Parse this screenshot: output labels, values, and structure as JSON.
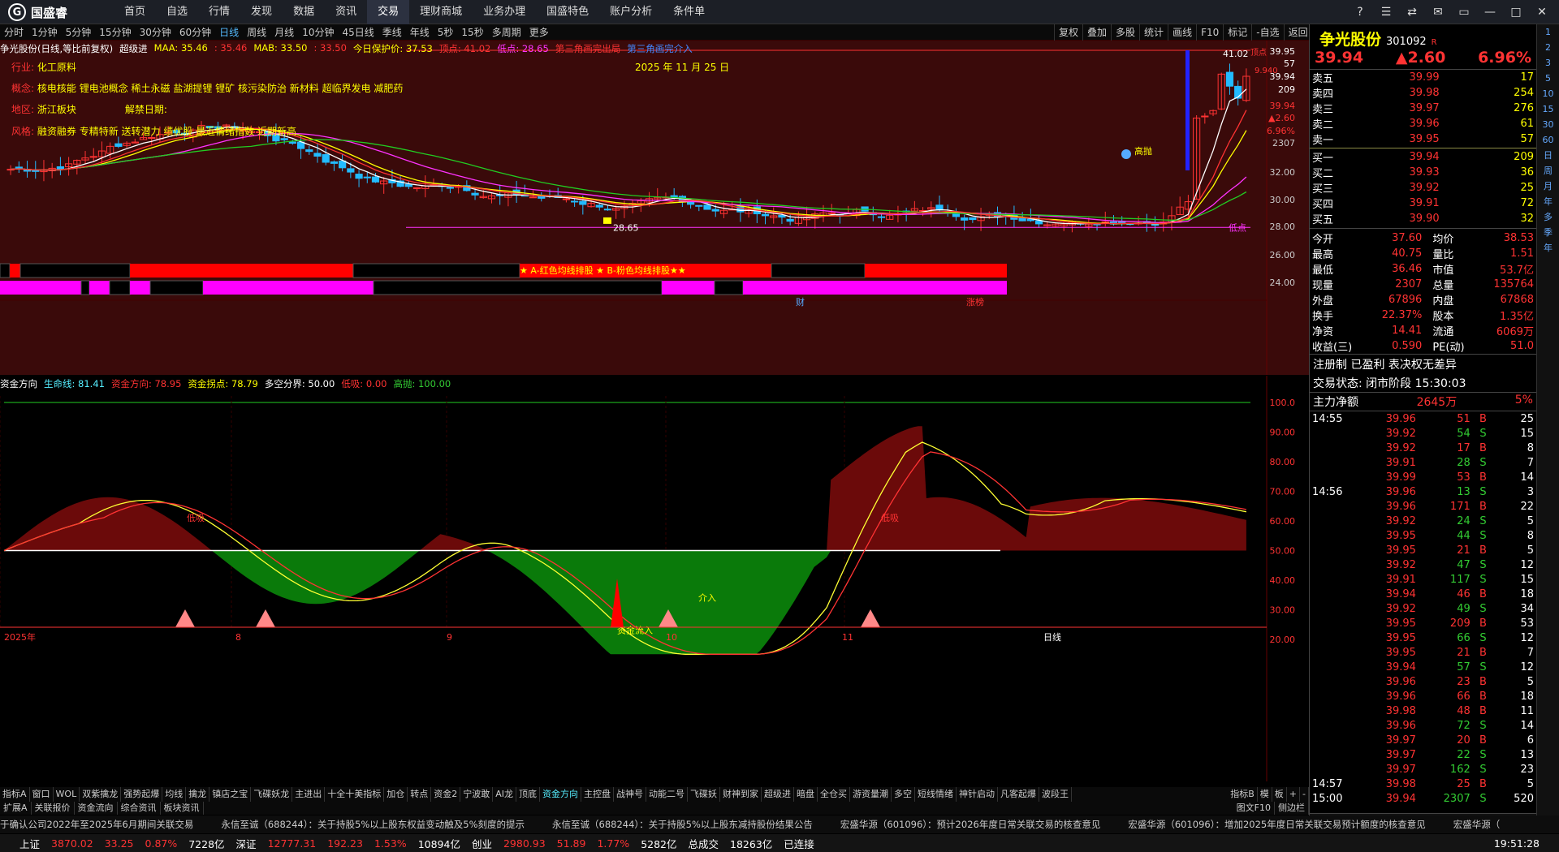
{
  "app": {
    "name": "国盛睿"
  },
  "menu": [
    "首页",
    "自选",
    "行情",
    "发现",
    "数据",
    "资讯",
    "交易",
    "理财商城",
    "业务办理",
    "国盛特色",
    "账户分析",
    "条件单"
  ],
  "menu_active": 6,
  "window_controls": [
    "?",
    "☰",
    "⇄",
    "✉",
    "▭",
    "—",
    "□",
    "✕"
  ],
  "periods": [
    "分时",
    "1分钟",
    "5分钟",
    "15分钟",
    "30分钟",
    "60分钟",
    "日线",
    "周线",
    "月线",
    "10分钟",
    "45日线",
    "季线",
    "年线",
    "5秒",
    "15秒",
    "多周期",
    "更多"
  ],
  "periods_active": 6,
  "tools": [
    "复权",
    "叠加",
    "多股",
    "统计",
    "画线",
    "F10",
    "标记",
    "-自选",
    "返回"
  ],
  "kline": {
    "title": "争光股份(日线,等比前复权)",
    "indicator": "超级进",
    "maa": "MAA: 35.46",
    "maa2": ": 35.46",
    "mab": "MAB: 33.50",
    "mab2": ": 33.50",
    "guard": "今日保护价: 37.53",
    "top": "顶点: 41.02",
    "bottom": "低点: 28.65",
    "t3": "第三角画完出局",
    "t3b": "第三角画完介入",
    "date_label": "2025 年 11 月 25 日",
    "industry_k": "行业:",
    "industry_v": "化工原料",
    "concept_k": "概念:",
    "concept_v": "核电核能 锂电池概念 稀土永磁 盐湖提锂 锂矿 核污染防治 新材料 超临界发电 减肥药",
    "region_k": "地区:",
    "region_v": "浙江板块",
    "ban_k": "解禁日期:",
    "style_k": "风格:",
    "style_v": "融资融券 专精特新 送转潜力 绩优股 最近情绪指数 近期新高",
    "high_val": "41.02",
    "high_tag": "顶点",
    "low_val": "28.65",
    "low_tag": "低点",
    "gaopao": "高抛",
    "close_tag": "9.940",
    "strip_text": "★ A-红色均线排股 ★ B-粉色均线排股★★",
    "cai": "财",
    "zhangting": "涨榜",
    "y_ticks": [
      "39.95",
      "57",
      "39.94",
      "209",
      "39.94",
      "▲2.60",
      "6.96%",
      "2307",
      "32.00",
      "30.00",
      "28.00",
      "26.00",
      "24.00"
    ]
  },
  "ind": {
    "title": "资金方向",
    "life": "生命线: 81.41",
    "dir": "资金方向: 78.95",
    "turn": "资金拐点: 78.79",
    "split": "多空分界: 50.00",
    "low": "低吸: 0.00",
    "high": "高抛: 100.00",
    "labels": {
      "diba": "低吸",
      "in1": "资金流入",
      "in2": "介入",
      "dibu2": "低吸"
    },
    "y_ticks": [
      "100.0",
      "90.00",
      "80.00",
      "70.00",
      "60.00",
      "50.00",
      "40.00",
      "30.00",
      "20.00"
    ],
    "x_ticks": [
      "2025年",
      "8",
      "9",
      "10",
      "11"
    ]
  },
  "chart_data": {
    "type": "line",
    "x": [
      "2025-07",
      "2025-08",
      "2025-09",
      "2025-10",
      "2025-11"
    ],
    "series": [
      {
        "name": "生命线",
        "values": [
          70,
          62,
          30,
          45,
          81.41
        ]
      },
      {
        "name": "资金方向",
        "values": [
          68,
          63,
          28,
          42,
          78.95
        ]
      }
    ],
    "ylim": [
      0,
      100
    ]
  },
  "bottomtabs": [
    "指标A",
    "窗口",
    "WOL",
    "双紫擒龙",
    "强势起爆",
    "均线",
    "擒龙",
    "镇店之宝",
    "飞碟妖龙",
    "主进出",
    "十全十美指标",
    "加仓",
    "转点",
    "资金2",
    "宁波敢",
    "AI龙",
    "顶底",
    "资金方向",
    "主控盘",
    "战神号",
    "动能二号",
    "飞碟妖",
    "财神到家",
    "超级进",
    "暗盘",
    "全仓买",
    "游资量潮",
    "多空",
    "短线情绪",
    "神针启动",
    "凡客起爆",
    "波段王"
  ],
  "bottomtabs_right": [
    "指标B",
    "模",
    "板",
    "+",
    "-"
  ],
  "bottomtabs2": [
    "扩展A",
    "关联报价",
    "资金流向",
    "综合资讯",
    "板块资讯"
  ],
  "bottom_right": [
    "图文F10",
    "侧边栏"
  ],
  "ticker": [
    "于确认公司2022年至2025年6月期间关联交易",
    "永信至诚（688244）：关于持股5%以上股东权益变动触及5%刻度的提示",
    "永信至诚（688244）：关于持股5%以上股东减持股份结果公告",
    "宏盛华源（601096）：预计2026年度日常关联交易的核查意见",
    "宏盛华源（601096）：增加2025年度日常关联交易预计额度的核查意见",
    "宏盛华源（"
  ],
  "status": [
    {
      "n": "上证",
      "v": "3870.02",
      "c": "33.25",
      "p": "0.87%",
      "a": "7228亿"
    },
    {
      "n": "深证",
      "v": "12777.31",
      "c": "192.23",
      "p": "1.53%",
      "a": "10894亿"
    },
    {
      "n": "创业",
      "v": "2980.93",
      "c": "51.89",
      "p": "1.77%",
      "a": "5282亿"
    }
  ],
  "total_label": "总成交",
  "total": "18263亿",
  "conn": "已连接",
  "clock": "19:51:28",
  "quote": {
    "name": "争光股份",
    "code": "301092",
    "tag": "R",
    "price": "39.94",
    "chg": "▲2.60",
    "pct": "6.96%",
    "asks": [
      [
        "卖五",
        "39.99",
        "17"
      ],
      [
        "卖四",
        "39.98",
        "254"
      ],
      [
        "卖三",
        "39.97",
        "276"
      ],
      [
        "卖二",
        "39.96",
        "61"
      ],
      [
        "卖一",
        "39.95",
        "57"
      ]
    ],
    "bids": [
      [
        "买一",
        "39.94",
        "209"
      ],
      [
        "买二",
        "39.93",
        "36"
      ],
      [
        "买三",
        "39.92",
        "25"
      ],
      [
        "买四",
        "39.91",
        "72"
      ],
      [
        "买五",
        "39.90",
        "32"
      ]
    ],
    "stats": [
      [
        "今开",
        "37.60",
        "均价",
        "38.53"
      ],
      [
        "最高",
        "40.75",
        "量比",
        "1.51"
      ],
      [
        "最低",
        "36.46",
        "市值",
        "53.7亿"
      ],
      [
        "现量",
        "2307",
        "总量",
        "135764"
      ],
      [
        "外盘",
        "67896",
        "内盘",
        "67868"
      ],
      [
        "换手",
        "22.37%",
        "股本",
        "1.35亿"
      ],
      [
        "净资",
        "14.41",
        "流通",
        "6069万"
      ],
      [
        "收益(三)",
        "0.590",
        "PE(动)",
        "51.0"
      ]
    ],
    "reg": "注册制 已盈利 表决权无差异",
    "state": "交易状态: 闭市阶段 15:30:03",
    "net_k": "主力净额",
    "net_v": "2645万",
    "net_p": "5%",
    "trades": [
      [
        "14:55",
        "39.96",
        "51",
        "B",
        "25"
      ],
      [
        "",
        "39.92",
        "54",
        "S",
        "15"
      ],
      [
        "",
        "39.92",
        "17",
        "B",
        "8"
      ],
      [
        "",
        "39.91",
        "28",
        "S",
        "7"
      ],
      [
        "",
        "39.99",
        "53",
        "B",
        "14"
      ],
      [
        "14:56",
        "39.96",
        "13",
        "S",
        "3"
      ],
      [
        "",
        "39.96",
        "171",
        "B",
        "22"
      ],
      [
        "",
        "39.92",
        "24",
        "S",
        "5"
      ],
      [
        "",
        "39.95",
        "44",
        "S",
        "8"
      ],
      [
        "",
        "39.95",
        "21",
        "B",
        "5"
      ],
      [
        "",
        "39.92",
        "47",
        "S",
        "12"
      ],
      [
        "",
        "39.91",
        "117",
        "S",
        "15"
      ],
      [
        "",
        "39.94",
        "46",
        "B",
        "18"
      ],
      [
        "",
        "39.92",
        "49",
        "S",
        "34"
      ],
      [
        "",
        "39.95",
        "209",
        "B",
        "53"
      ],
      [
        "",
        "39.95",
        "66",
        "S",
        "12"
      ],
      [
        "",
        "39.95",
        "21",
        "B",
        "7"
      ],
      [
        "",
        "39.94",
        "57",
        "S",
        "12"
      ],
      [
        "",
        "39.96",
        "23",
        "B",
        "5"
      ],
      [
        "",
        "39.96",
        "66",
        "B",
        "18"
      ],
      [
        "",
        "39.98",
        "48",
        "B",
        "11"
      ],
      [
        "",
        "39.96",
        "72",
        "S",
        "14"
      ],
      [
        "",
        "39.97",
        "20",
        "B",
        "6"
      ],
      [
        "",
        "39.97",
        "22",
        "S",
        "13"
      ],
      [
        "",
        "39.97",
        "162",
        "S",
        "23"
      ],
      [
        "14:57",
        "39.98",
        "25",
        "B",
        "5"
      ],
      [
        "15:00",
        "39.94",
        "2307",
        "S",
        "520"
      ]
    ],
    "bottom_tabs": [
      "笔",
      "价",
      "细",
      "势",
      "联",
      "值",
      "主",
      "逆",
      "筹"
    ]
  },
  "sidebar": [
    "1",
    "2",
    "3",
    "5",
    "10",
    "15",
    "30",
    "60",
    "日",
    "周",
    "月",
    "年",
    "多",
    "季",
    "年"
  ],
  "colors": {
    "up": "#ff3333",
    "down": "#33cc33",
    "bg_kline": "#3a0a0a",
    "magenta": "#ff33ff",
    "yellow": "#ffff00"
  }
}
